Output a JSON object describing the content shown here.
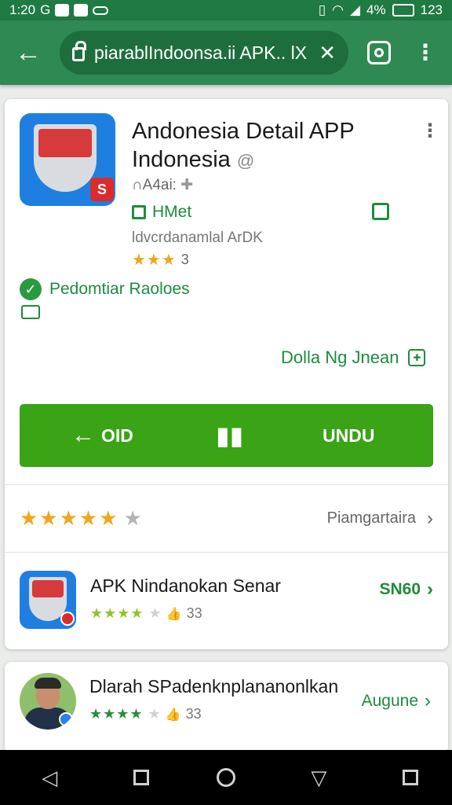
{
  "status_bar": {
    "time": "1:20",
    "carrier": "G",
    "right_text": "4%",
    "battery_num": "123"
  },
  "browser": {
    "url": "piarablIndoonsa.ii APK.. lX",
    "clear_glyph": "✕"
  },
  "app": {
    "title_line1": "Andonesia Detail APP",
    "title_line2": "Indonesia",
    "title_at": "@",
    "dev": "∩A4ai:",
    "tag": "HMet",
    "package": "ldvcrdanamlal ArDK",
    "rating_num": "3",
    "rating_stars": 3
  },
  "verified": {
    "label": "Pedomtiar Raoloes"
  },
  "download_link": {
    "label": "Dolla Ng Jnean"
  },
  "action_button": {
    "left_label": "OID",
    "right_label": "UNDU"
  },
  "rating_row": {
    "stars_filled": 5,
    "link_label": "Piamgartaira"
  },
  "list": [
    {
      "title": "APK Nindanokan Senar",
      "rating_count": "33",
      "action": "SN60",
      "stars": 4
    },
    {
      "title": "Dlarah SPadenknplananonlkan",
      "rating_count": "33",
      "action": "Augune",
      "stars": 4
    }
  ],
  "colors": {
    "appbar": "#2e8a52",
    "accent_green": "#3aa316",
    "star": "#f2a51c"
  }
}
